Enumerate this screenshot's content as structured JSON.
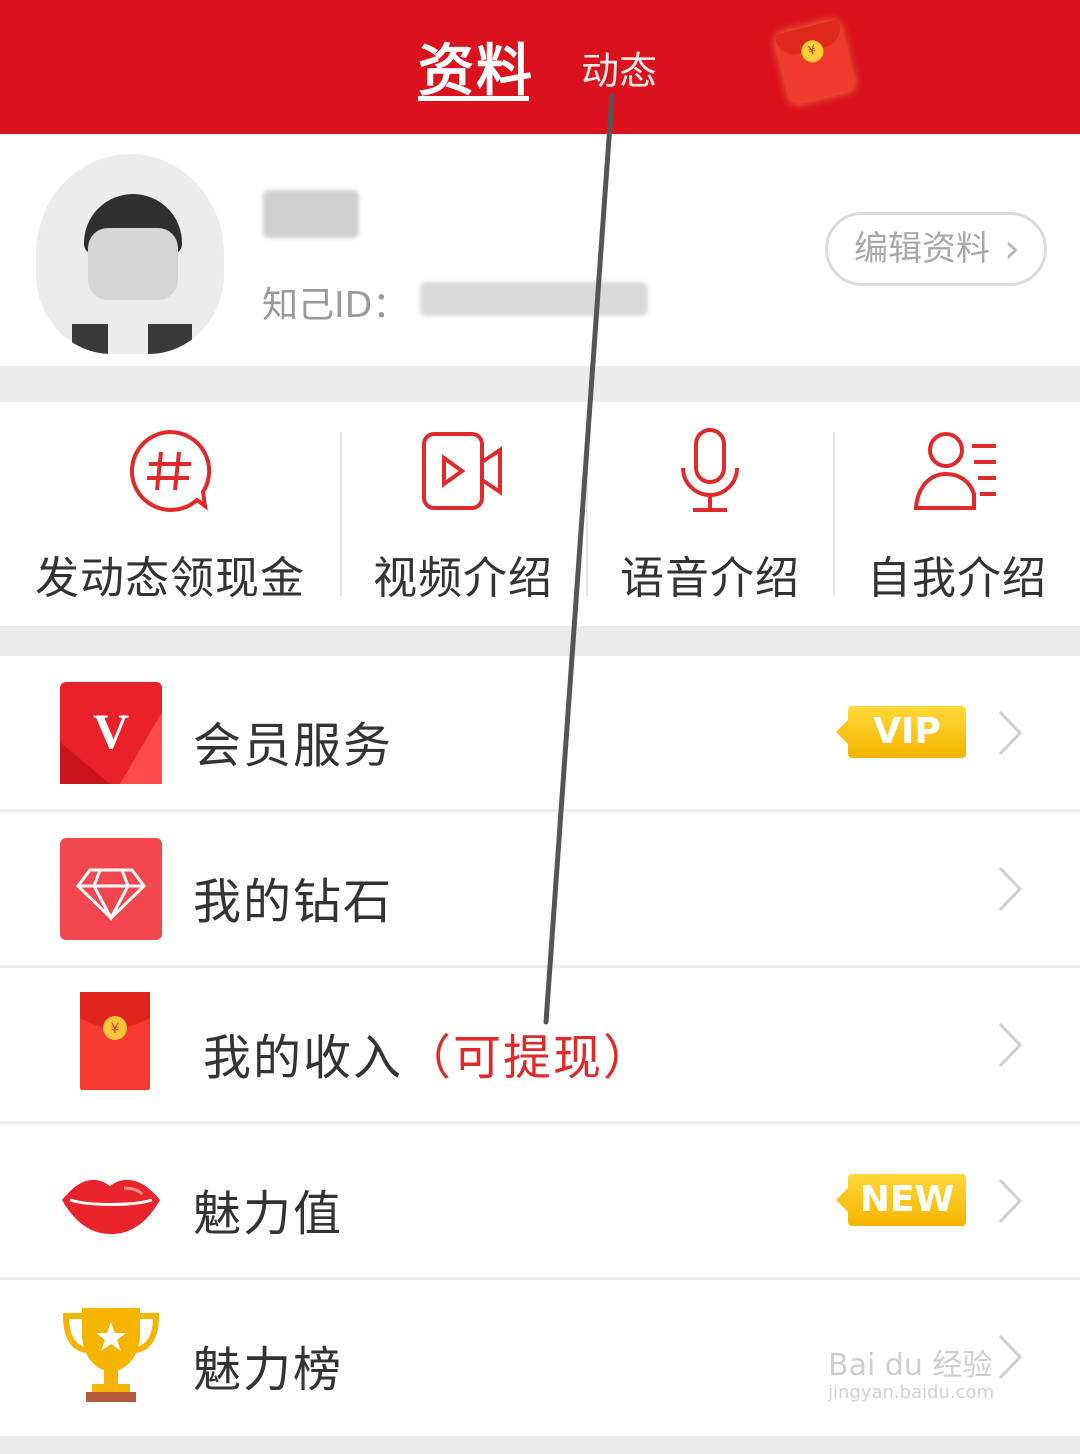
{
  "header": {
    "tabs": [
      {
        "label": "资料",
        "active": true
      },
      {
        "label": "动态",
        "active": false
      }
    ],
    "brand_color": "#d9121d",
    "redpacket_icon": "red-envelope-icon"
  },
  "profile": {
    "id_label": "知己ID：",
    "edit_button": "编辑资料"
  },
  "actions": [
    {
      "label": "发动态领现金",
      "icon": "hashtag-chat-icon"
    },
    {
      "label": "视频介绍",
      "icon": "video-camera-icon"
    },
    {
      "label": "语音介绍",
      "icon": "microphone-icon"
    },
    {
      "label": "自我介绍",
      "icon": "profile-list-icon"
    }
  ],
  "menu": [
    {
      "label": "会员服务",
      "badge": "VIP",
      "icon": "vip-v-icon"
    },
    {
      "label": "我的钻石",
      "icon": "diamond-icon"
    },
    {
      "label": "我的收入",
      "highlight": "（可提现）",
      "icon": "red-envelope-icon"
    },
    {
      "label": "魅力值",
      "badge": "NEW",
      "icon": "lips-icon"
    },
    {
      "label": "魅力榜",
      "icon": "trophy-icon"
    }
  ],
  "watermark": {
    "text": "Bai du 经验",
    "url": "jingyan.baidu.com"
  }
}
